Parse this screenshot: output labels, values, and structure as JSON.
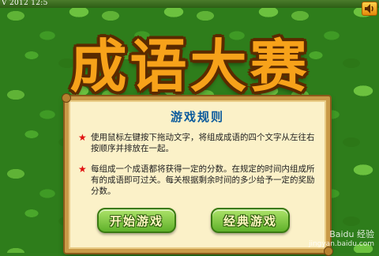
{
  "header": {
    "date_text": "V 2012 12:5"
  },
  "game": {
    "title": "成语大赛"
  },
  "rules": {
    "heading": "游戏规则",
    "items": [
      {
        "star": "★",
        "text": "使用鼠标左键按下拖动文字，将组成成语的四个文字从左往右按顺序并排放在一起。"
      },
      {
        "star": "★",
        "text": "每组成一个成语都将获得一定的分数。在规定的时间内组成所有的成语即可过关。每关根据剩余时间的多少给予一定的奖励分数。"
      }
    ]
  },
  "buttons": {
    "start_label": "开始游戏",
    "classic_label": "经典游戏"
  },
  "watermark": {
    "brand": "Baidu 经验",
    "url": "jingyan.baidu.com"
  },
  "colors": {
    "title": "#f7a21a",
    "rules_heading": "#0a5a9c",
    "star": "#e01010",
    "button": "#5fb12a"
  },
  "icons": {
    "sound": "speaker-icon"
  }
}
